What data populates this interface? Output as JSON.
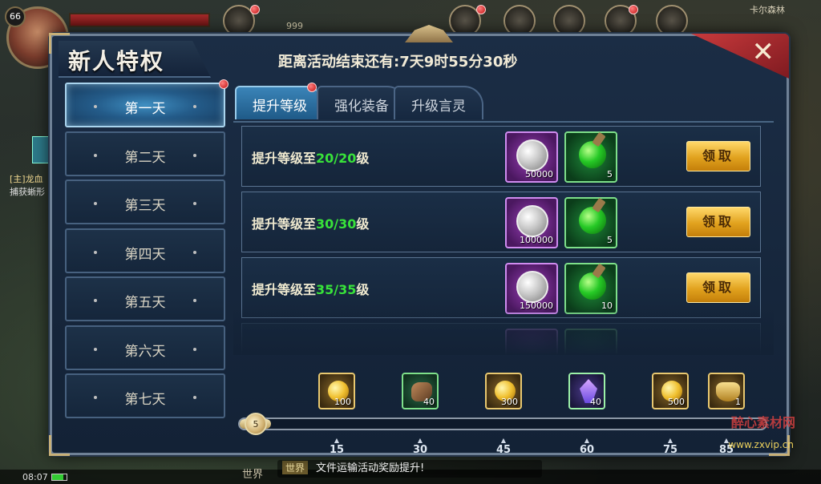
{
  "hud": {
    "level": "66",
    "power_text": "999",
    "map_name": "卡尔森林",
    "quest_lines": [
      "[主]龙血",
      "捕获蜥形"
    ],
    "clock": "08:07"
  },
  "dialog": {
    "title": "新人特权",
    "countdown": "距离活动结束还有:7天9时55分30秒",
    "close_label": "✕"
  },
  "days": [
    {
      "label": "第一天",
      "active": true,
      "badge": true
    },
    {
      "label": "第二天",
      "active": false,
      "badge": false
    },
    {
      "label": "第三天",
      "active": false,
      "badge": false
    },
    {
      "label": "第四天",
      "active": false,
      "badge": false
    },
    {
      "label": "第五天",
      "active": false,
      "badge": false
    },
    {
      "label": "第六天",
      "active": false,
      "badge": false
    },
    {
      "label": "第七天",
      "active": false,
      "badge": false
    }
  ],
  "tabs": [
    {
      "label": "提升等级",
      "active": true,
      "badge": true
    },
    {
      "label": "强化装备",
      "active": false,
      "badge": false
    },
    {
      "label": "升级言灵",
      "active": false,
      "badge": false
    }
  ],
  "rewards": [
    {
      "req_prefix": "提升等级至",
      "req_level": "20/20",
      "req_suffix": "级",
      "silver_qty": "50000",
      "potion_qty": "5",
      "button": "领取"
    },
    {
      "req_prefix": "提升等级至",
      "req_level": "30/30",
      "req_suffix": "级",
      "silver_qty": "100000",
      "potion_qty": "5",
      "button": "领取"
    },
    {
      "req_prefix": "提升等级至",
      "req_level": "35/35",
      "req_suffix": "级",
      "silver_qty": "150000",
      "potion_qty": "10",
      "button": "领取"
    }
  ],
  "milestones": [
    {
      "icon": "gold-coin",
      "qty": "100",
      "tick": "15"
    },
    {
      "icon": "ore-stone",
      "qty": "40",
      "tick": "30"
    },
    {
      "icon": "gold-coin",
      "qty": "300",
      "tick": "45"
    },
    {
      "icon": "crystal",
      "qty": "40",
      "tick": "60"
    },
    {
      "icon": "gold-coin",
      "qty": "500",
      "tick": "75"
    },
    {
      "icon": "chariot",
      "qty": "1",
      "tick": "85"
    }
  ],
  "progress": {
    "current": "5",
    "fraction": 0.06
  },
  "chat": {
    "tab": "世界",
    "channel": "世界",
    "message": "文件运输活动奖励提升!"
  },
  "watermark": {
    "line1": "醉心素材网",
    "line2": "www.zxvip.cn"
  },
  "colors": {
    "level_text": "#38e23a",
    "claim_button": "#e1a21e",
    "active_tab": "#3a84b8",
    "close_button": "#c93a3c"
  }
}
